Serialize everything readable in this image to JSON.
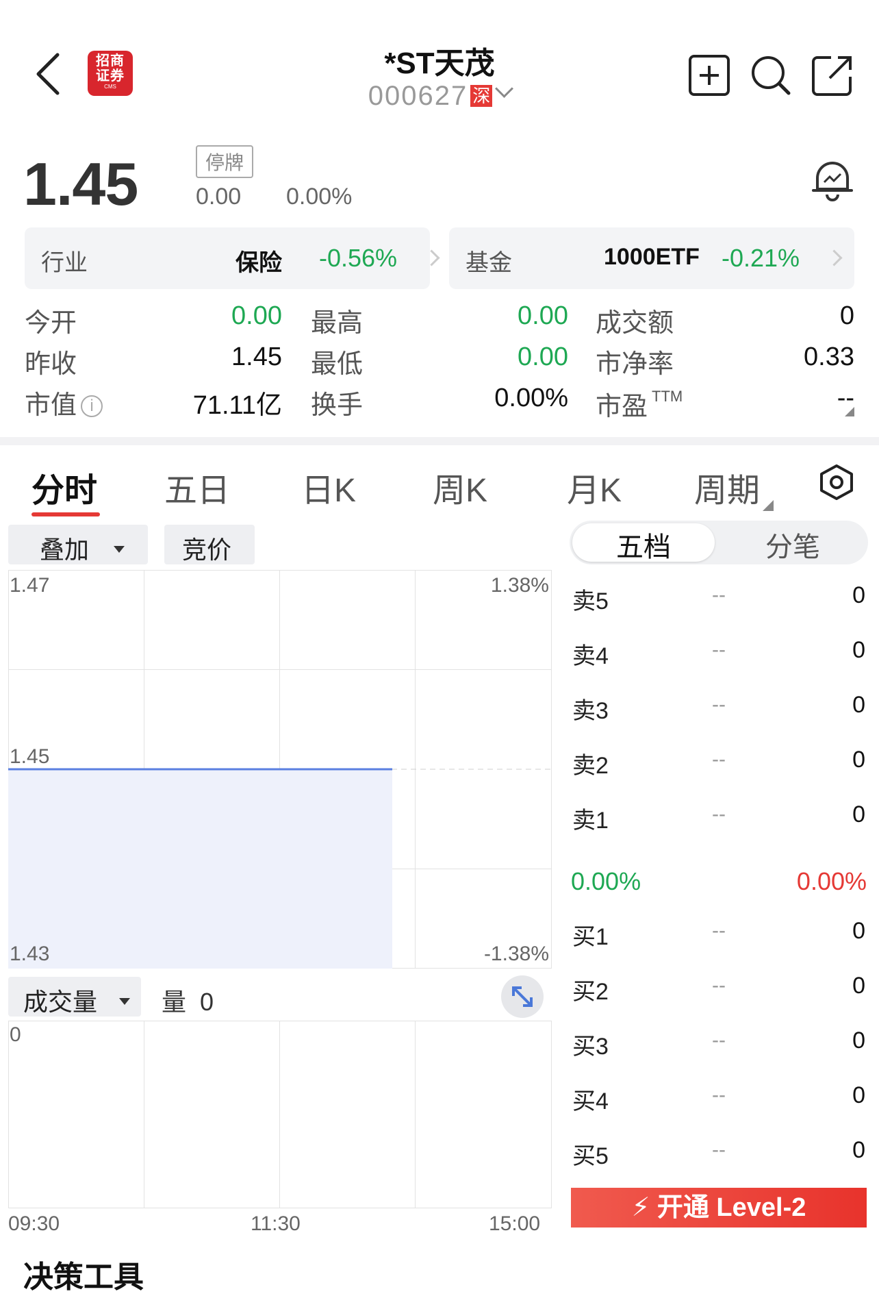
{
  "header": {
    "back": "back",
    "logo_line1": "招商",
    "logo_line2": "证券",
    "logo_sub": "CMS",
    "title": "*ST天茂",
    "code": "000627",
    "exchange": "深",
    "icons": [
      "back-icon",
      "add-watchlist-icon",
      "search-icon",
      "share-icon"
    ]
  },
  "price": {
    "last": "1.45",
    "status": "停牌",
    "change": "0.00",
    "change_pct": "0.00%"
  },
  "industry": {
    "label": "行业",
    "name": "保险",
    "pct": "-0.56%"
  },
  "fund": {
    "label": "基金",
    "name": "1000ETF",
    "pct": "-0.21%"
  },
  "quotes": {
    "open_label": "今开",
    "open": "0.00",
    "high_label": "最高",
    "high": "0.00",
    "turnover_amt_label": "成交额",
    "turnover_amt": "0",
    "prev_close_label": "昨收",
    "prev_close": "1.45",
    "low_label": "最低",
    "low": "0.00",
    "pb_label": "市净率",
    "pb": "0.33",
    "mktcap_label": "市值",
    "mktcap": "71.11亿",
    "turnover_rate_label": "换手",
    "turnover_rate": "0.00%",
    "pe_label": "市盈",
    "pe_sup": "TTM",
    "pe": "--"
  },
  "tabs": [
    "分时",
    "五日",
    "日K",
    "周K",
    "月K",
    "周期"
  ],
  "active_tab": "分时",
  "chart_controls": {
    "overlay": "叠加",
    "auction": "竞价"
  },
  "chart": {
    "y_top": "1.47",
    "y_mid": "1.45",
    "y_bot": "1.43",
    "pct_top": "1.38%",
    "pct_bot": "-1.38%",
    "x_labels": [
      "09:30",
      "11:30",
      "15:00"
    ]
  },
  "chart_data": {
    "type": "line",
    "title": "",
    "x": [
      "09:30",
      "11:30",
      "15:00"
    ],
    "series": [
      {
        "values": [
          1.45,
          1.45
        ]
      }
    ],
    "ylim": [
      1.43,
      1.47
    ],
    "prev_close": 1.45,
    "grid": true
  },
  "volume": {
    "selector": "成交量",
    "label": "量",
    "value": "0",
    "y_top": "0"
  },
  "orderbook": {
    "tab_active": "五档",
    "tab_other": "分笔",
    "asks": [
      {
        "label": "卖5",
        "price": "--",
        "vol": "0"
      },
      {
        "label": "卖4",
        "price": "--",
        "vol": "0"
      },
      {
        "label": "卖3",
        "price": "--",
        "vol": "0"
      },
      {
        "label": "卖2",
        "price": "--",
        "vol": "0"
      },
      {
        "label": "卖1",
        "price": "--",
        "vol": "0"
      }
    ],
    "ratio_left": "0.00%",
    "ratio_right": "0.00%",
    "bids": [
      {
        "label": "买1",
        "price": "--",
        "vol": "0"
      },
      {
        "label": "买2",
        "price": "--",
        "vol": "0"
      },
      {
        "label": "买3",
        "price": "--",
        "vol": "0"
      },
      {
        "label": "买4",
        "price": "--",
        "vol": "0"
      },
      {
        "label": "买5",
        "price": "--",
        "vol": "0"
      }
    ],
    "level2": "开通 Level-2"
  },
  "footer_cut": "决策工具",
  "colors": {
    "up": "#e53935",
    "down": "#1ea853",
    "line": "#5a7fe0",
    "fill": "#eef1fb"
  }
}
